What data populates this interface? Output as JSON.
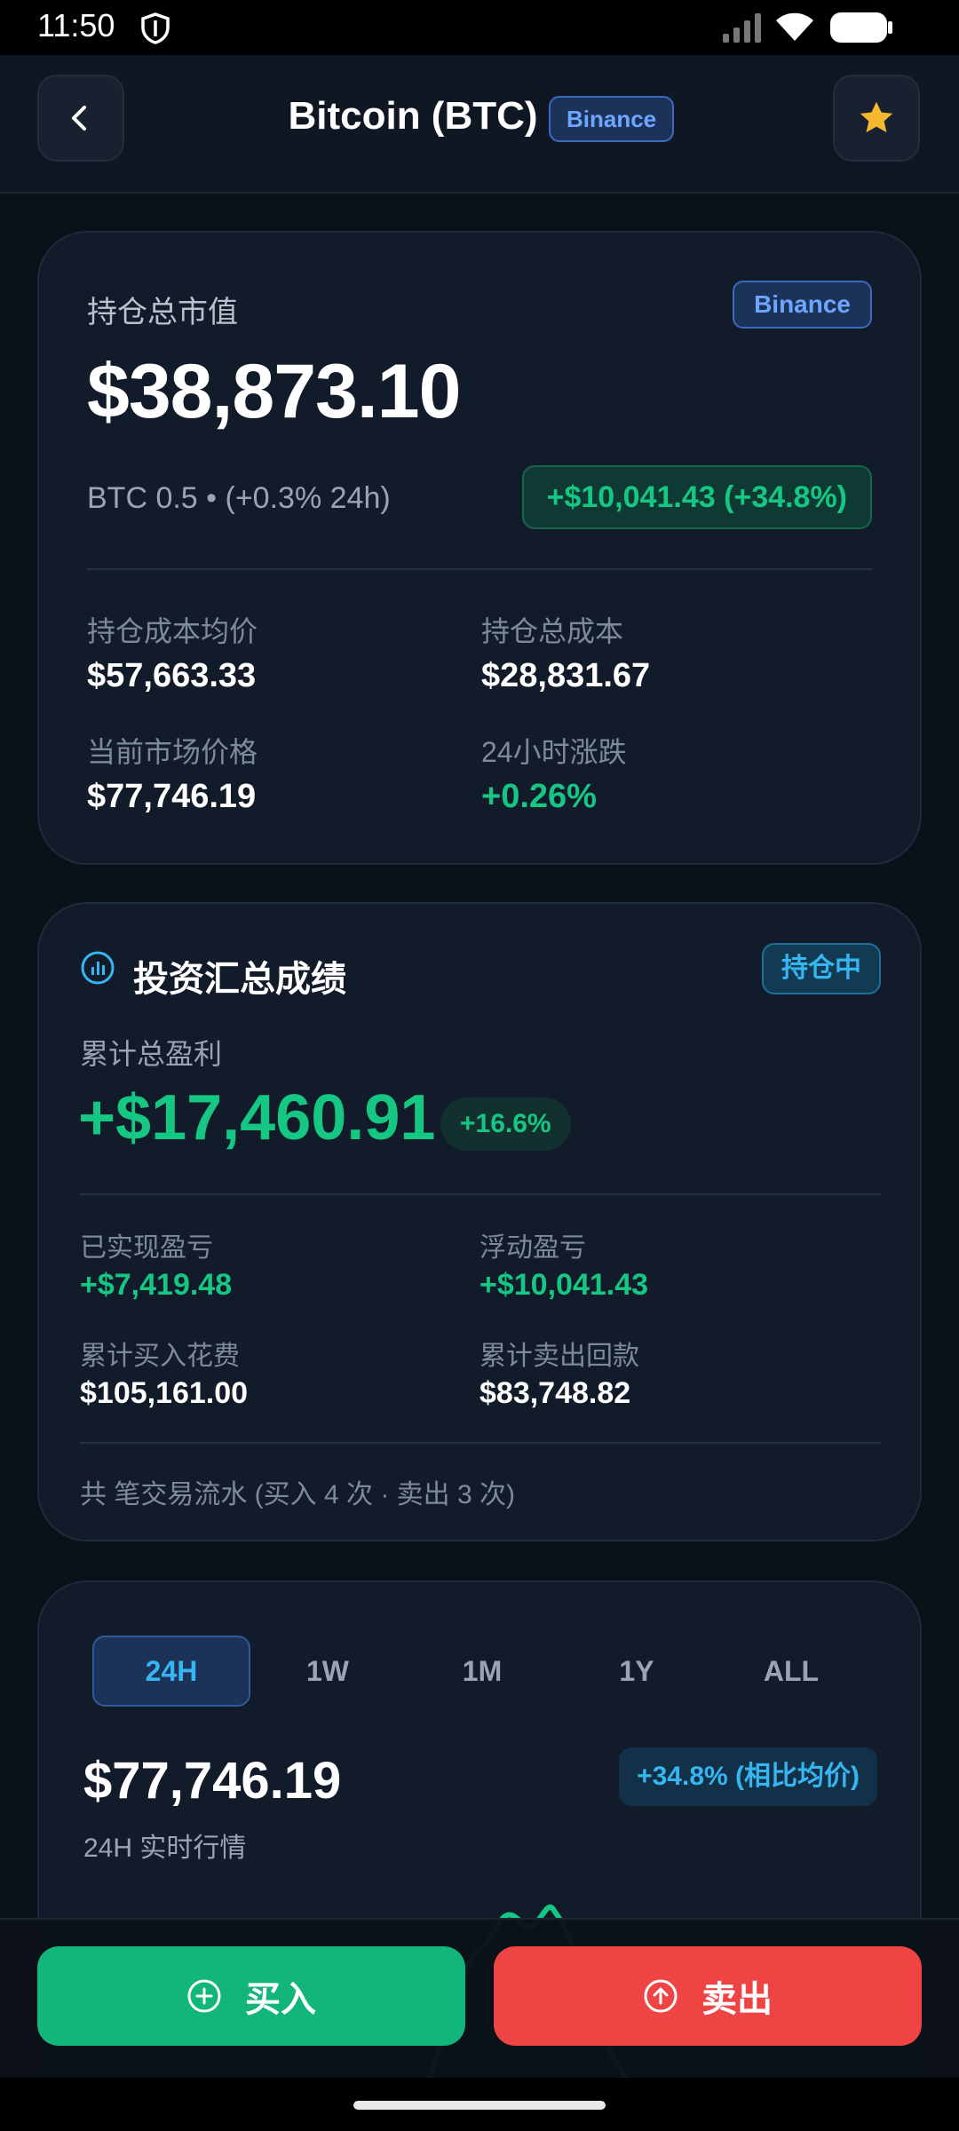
{
  "status_bar": {
    "time": "11:50"
  },
  "header": {
    "title": "Bitcoin (BTC)",
    "exchange": "Binance"
  },
  "position_card": {
    "label": "持仓总市值",
    "exchange": "Binance",
    "total_value": "$38,873.10",
    "holding_line": "BTC 0.5 • (+0.3% 24h)",
    "unrealized_gain": "+$10,041.43 (+34.8%)",
    "stats": [
      {
        "label": "持仓成本均价",
        "value": "$57,663.33"
      },
      {
        "label": "持仓总成本",
        "value": "$28,831.67"
      },
      {
        "label": "当前市场价格",
        "value": "$77,746.19"
      },
      {
        "label": "24小时涨跌",
        "value": "+0.26%"
      }
    ]
  },
  "summary_card": {
    "title": "投资汇总成绩",
    "status": "持仓中",
    "cum_label": "累计总盈利",
    "cum_value": "+$17,460.91",
    "cum_pct": "+16.6%",
    "stats": [
      {
        "label": "已实现盈亏",
        "value": "+$7,419.48"
      },
      {
        "label": "浮动盈亏",
        "value": "+$10,041.43"
      },
      {
        "label": "累计买入花费",
        "value": "$105,161.00"
      },
      {
        "label": "累计卖出回款",
        "value": "$83,748.82"
      }
    ],
    "footer": "共 笔交易流水 (买入 4 次 · 卖出 3 次)"
  },
  "chart_card": {
    "tabs": [
      "24H",
      "1W",
      "1M",
      "1Y",
      "ALL"
    ],
    "active_tab": "24H",
    "price": "$77,746.19",
    "price_sub": "24H 实时行情",
    "vs_avg": "+34.8% (相比均价)"
  },
  "actions": {
    "buy": "买入",
    "sell": "卖出"
  },
  "colors": {
    "bg": "#0b1119",
    "card": "#121b29",
    "green": "#16c784",
    "red": "#ef4444",
    "blue": "#36b6f0"
  }
}
